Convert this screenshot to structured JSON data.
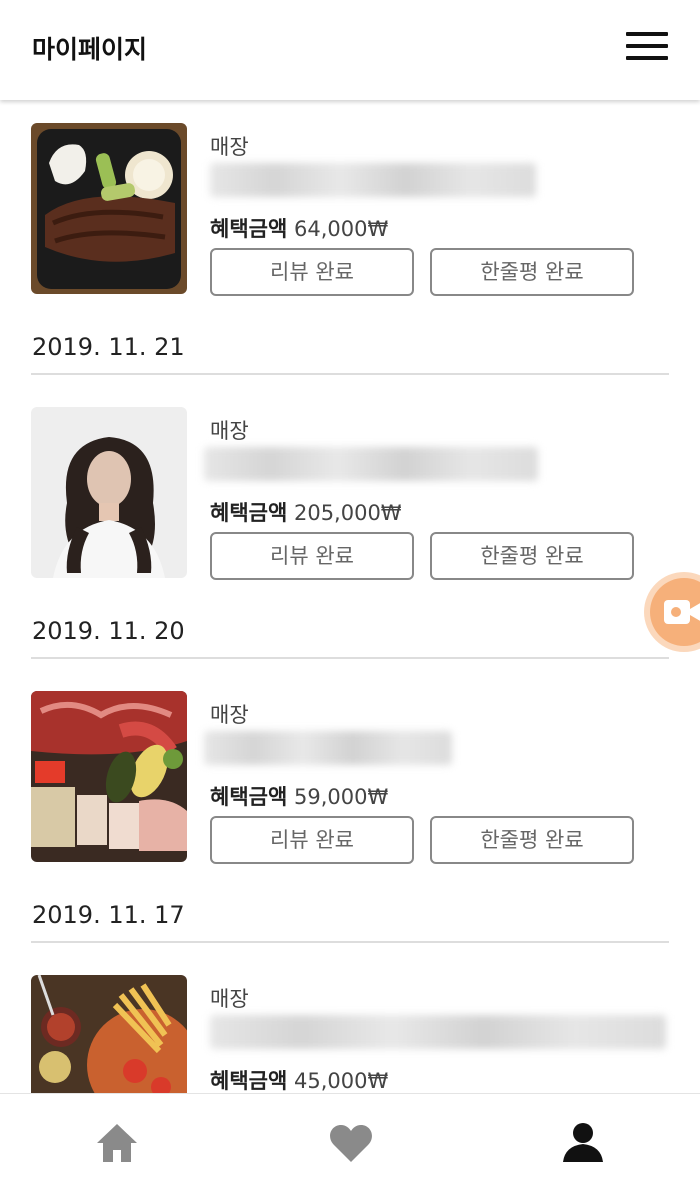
{
  "header": {
    "title": "마이페이지",
    "menu_icon": "hamburger-menu-icon"
  },
  "orders": [
    {
      "date": "",
      "store_label": "매장",
      "benefit_label": "혜택금액",
      "benefit_amount": "64,000₩",
      "review_button": "리뷰 완료",
      "oneline_button": "한줄평 완료",
      "image": "steak-photo"
    },
    {
      "date": "2019. 11. 21",
      "store_label": "매장",
      "benefit_label": "혜택금액",
      "benefit_amount": "205,000₩",
      "review_button": "리뷰 완료",
      "oneline_button": "한줄평 완료",
      "image": "hair-model-photo"
    },
    {
      "date": "2019. 11. 20",
      "store_label": "매장",
      "benefit_label": "혜택금액",
      "benefit_amount": "59,000₩",
      "review_button": "리뷰 완료",
      "oneline_button": "한줄평 완료",
      "image": "bbq-platter-photo"
    },
    {
      "date": "2019. 11. 17",
      "store_label": "매장",
      "benefit_label": "혜택금액",
      "benefit_amount": "45,000₩",
      "image": "pizza-fries-photo"
    }
  ],
  "floating_button": {
    "icon": "video-camera-icon",
    "color": "#f6b07a"
  },
  "tabbar": {
    "items": [
      {
        "icon": "home-icon",
        "active": false
      },
      {
        "icon": "heart-icon",
        "active": false
      },
      {
        "icon": "person-icon",
        "active": true
      }
    ],
    "active_color": "#111111",
    "inactive_color": "#8a8a8a"
  }
}
